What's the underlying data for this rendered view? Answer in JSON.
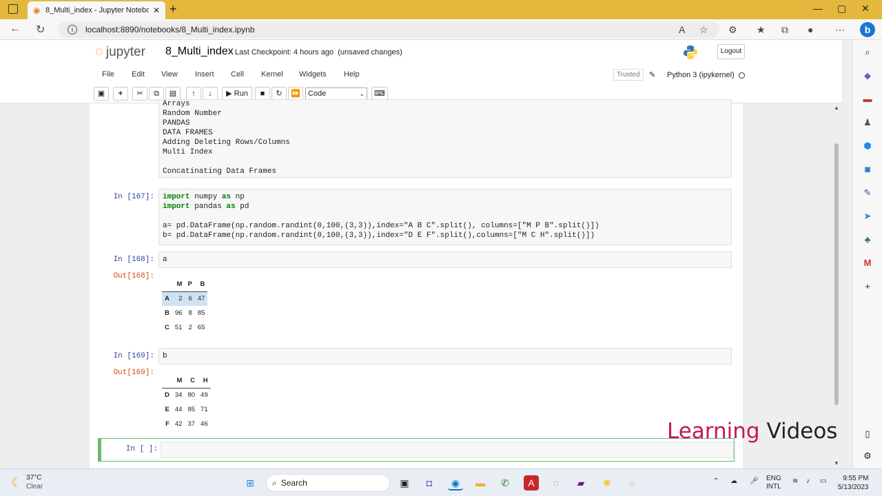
{
  "browser": {
    "tab_title": "8_Multi_index - Jupyter Notebo",
    "url": "localhost:8890/notebooks/8_Multi_index.ipynb"
  },
  "jupyter": {
    "logo_text": "jupyter",
    "notebook_name": "8_Multi_index",
    "checkpoint": "Last Checkpoint: 4 hours ago  (unsaved changes)",
    "logout_label": "Logout",
    "menu": [
      "File",
      "Edit",
      "View",
      "Insert",
      "Cell",
      "Kernel",
      "Widgets",
      "Help"
    ],
    "trusted": "Trusted",
    "kernel": "Python 3 (ipykernel)",
    "run_label": "Run",
    "cell_type": "Code"
  },
  "cells": {
    "markdown_lines": [
      "Arrays",
      "Random Number",
      "PANDAS",
      "DATA FRAMES",
      "Adding Deleting Rows/Columns",
      "Multi Index",
      "",
      "Concatinating Data Frames"
    ],
    "c167": {
      "prompt": "In [167]:",
      "lines": [
        "import numpy as np",
        "import pandas as pd",
        "",
        "a= pd.DataFrame(np.random.randint(0,100,(3,3)),index=\"A B C\".split(), columns=[\"M P B\".split()])",
        "b= pd.DataFrame(np.random.randint(0,100,(3,3)),index=\"D E F\".split(),columns=[\"M C H\".split()])"
      ]
    },
    "c168": {
      "prompt": "In [168]:",
      "code": "a",
      "out_prompt": "Out[168]:",
      "columns": [
        "M",
        "P",
        "B"
      ],
      "rows": [
        {
          "index": "A",
          "values": [
            "2",
            "6",
            "47"
          ]
        },
        {
          "index": "B",
          "values": [
            "96",
            "8",
            "85"
          ]
        },
        {
          "index": "C",
          "values": [
            "51",
            "2",
            "65"
          ]
        }
      ]
    },
    "c169": {
      "prompt": "In [169]:",
      "code": "b",
      "out_prompt": "Out[169]:",
      "columns": [
        "M",
        "C",
        "H"
      ],
      "rows": [
        {
          "index": "D",
          "values": [
            "34",
            "80",
            "49"
          ]
        },
        {
          "index": "E",
          "values": [
            "44",
            "85",
            "71"
          ]
        },
        {
          "index": "F",
          "values": [
            "42",
            "37",
            "46"
          ]
        }
      ]
    },
    "empty_prompt": "In [ ]:"
  },
  "watermark": {
    "word1": "Learning",
    "word2": "Videos"
  },
  "taskbar": {
    "temp": "37°C",
    "weather": "Clear",
    "search": "Search",
    "lang1": "ENG",
    "lang2": "INTL",
    "time": "9:55 PM",
    "date": "5/13/2023"
  },
  "colors": {
    "accent": "#f37726",
    "tabbar": "#e3b83c",
    "active_cell": "#66bb6a"
  }
}
